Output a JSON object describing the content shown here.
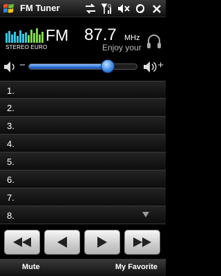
{
  "app": {
    "title": "FM Tuner"
  },
  "status_icons": [
    "sync-arrows-icon",
    "signal-antenna-icon",
    "speaker-muted-icon",
    "data-connection-icon",
    "close-icon"
  ],
  "radio": {
    "band": "FM",
    "frequency": "87.7",
    "unit": "MHz",
    "rds_text": "Enjoy your",
    "stereo_label": "STEREO EURO"
  },
  "volume": {
    "minus_label": "−",
    "plus_label": "+",
    "level_percent": 73
  },
  "presets": [
    {
      "label": "1."
    },
    {
      "label": "2."
    },
    {
      "label": "3."
    },
    {
      "label": "4."
    },
    {
      "label": "5."
    },
    {
      "label": "6."
    },
    {
      "label": "7."
    },
    {
      "label": "8."
    }
  ],
  "controls": [
    "seek-back-icon",
    "step-back-icon",
    "step-forward-icon",
    "seek-forward-icon"
  ],
  "softkeys": {
    "left": "Mute",
    "right": "My Favorite"
  },
  "colors": {
    "accent_blue": "#2f6fd6",
    "eq_cyan": "#35c8e6",
    "eq_green": "#7fd84a"
  }
}
